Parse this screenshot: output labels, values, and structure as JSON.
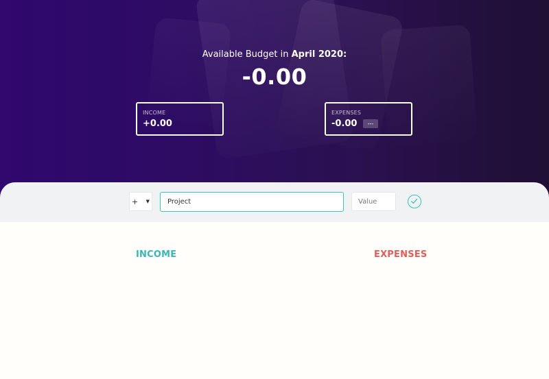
{
  "header": {
    "title_prefix": "Available Budget in",
    "month": "April 2020:",
    "budget_value": "-0.00"
  },
  "summary": {
    "income": {
      "label": "INCOME",
      "value": "+0.00"
    },
    "expenses": {
      "label": "EXPENSES",
      "value": "-0.00",
      "percentage": "---"
    }
  },
  "add_form": {
    "type_selected": "+",
    "description_value": "Project",
    "value_placeholder": "Value",
    "accent_color": "#39c2c1"
  },
  "lists": {
    "income_title": "INCOME",
    "expenses_title": "EXPENSES",
    "income_color": "#39b6b5",
    "expenses_color": "#e25d5a"
  }
}
